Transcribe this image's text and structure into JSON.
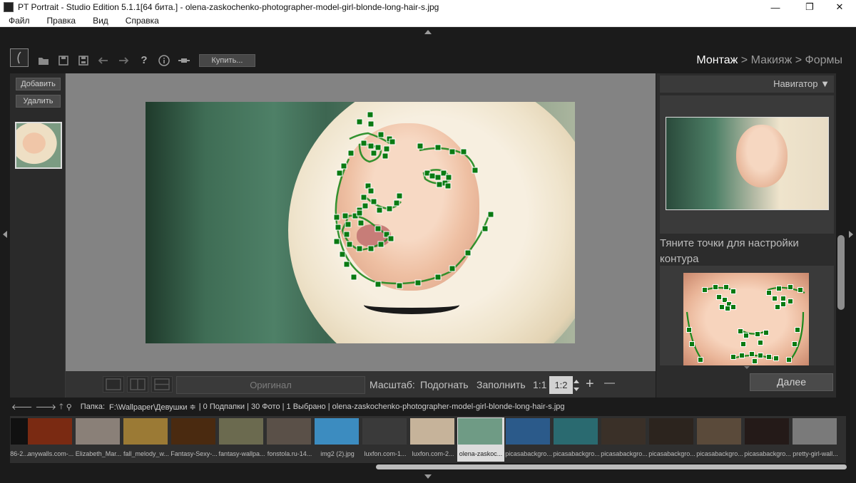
{
  "window": {
    "title": "PT Portrait - Studio Edition 5.1.1[64 бита.] - olena-zaskochenko-photographer-model-girl-blonde-long-hair-s.jpg",
    "controls": {
      "minimize": "—",
      "maximize": "❐",
      "close": "✕"
    }
  },
  "menu": [
    "Файл",
    "Правка",
    "Вид",
    "Справка"
  ],
  "toolbar": {
    "icons": [
      "app-logo-icon",
      "open-folder-icon",
      "save-icon",
      "save-as-icon",
      "undo-icon",
      "redo-icon",
      "help-icon",
      "info-icon",
      "plugin-icon"
    ],
    "buy_label": "Купить..."
  },
  "breadcrumb": {
    "step1": "Монтаж",
    "sep1": " > ",
    "step2": "Макияж",
    "sep2": " > ",
    "step3": "Формы"
  },
  "left_panel": {
    "add_label": "Добавить",
    "delete_label": "Удалить"
  },
  "view_bar": {
    "original_label": "Оригинал",
    "scale_label": "Масштаб:",
    "fit_label": "Подогнать",
    "fill_label": "Заполнить",
    "one_to_one": "1:1",
    "one_to_two": "1:2",
    "zoom_in": "+",
    "zoom_out": "—"
  },
  "right_panel": {
    "navigator_label": "Навигатор ▼",
    "hint": "Тяните точки для настройки контура",
    "next_label": "Далее"
  },
  "path_bar": {
    "folder_label": "Папка:",
    "folder_value": "F:\\Wallpaper\\Девушки ≑",
    "status": "| 0 Подпапки | 30 Фото | 1 Выбрано | olena-zaskochenko-photographer-model-girl-blonde-long-hair-s.jpg"
  },
  "filmstrip": [
    {
      "label": "86-2...",
      "color": "#111111",
      "selected": false
    },
    {
      "label": "anywalls.com-...",
      "color": "#7a2a12",
      "selected": false
    },
    {
      "label": "Elizabeth_Mar...",
      "color": "#8a8078",
      "selected": false
    },
    {
      "label": "fall_melody_w...",
      "color": "#9b7a35",
      "selected": false
    },
    {
      "label": "Fantasy-Sexy-...",
      "color": "#4a2a10",
      "selected": false
    },
    {
      "label": "fantasy-wallpa...",
      "color": "#6b6a4f",
      "selected": false
    },
    {
      "label": "fonstola.ru-14...",
      "color": "#5a5048",
      "selected": false
    },
    {
      "label": "img2 (2).jpg",
      "color": "#3c8cc0",
      "selected": false
    },
    {
      "label": "luxfon.com-1...",
      "color": "#3a3a3a",
      "selected": false
    },
    {
      "label": "luxfon.com-2...",
      "color": "#c6b39a",
      "selected": false
    },
    {
      "label": "olena-zaskoc...",
      "color": "#6f9b85",
      "selected": true
    },
    {
      "label": "picasabackgro...",
      "color": "#2b5a8a",
      "selected": false
    },
    {
      "label": "picasabackgro...",
      "color": "#2a6a70",
      "selected": false
    },
    {
      "label": "picasabackgro...",
      "color": "#3a3028",
      "selected": false
    },
    {
      "label": "picasabackgro...",
      "color": "#2c241e",
      "selected": false
    },
    {
      "label": "picasabackgro...",
      "color": "#5a4a3a",
      "selected": false
    },
    {
      "label": "picasabackgro...",
      "color": "#241a18",
      "selected": false
    },
    {
      "label": "pretty-girl-wall...",
      "color": "#7a7a7a",
      "selected": false
    }
  ],
  "colors": {
    "accent_point": "#0a7a12",
    "contour": "#1f8a1f",
    "panel": "#2c2c2c"
  }
}
